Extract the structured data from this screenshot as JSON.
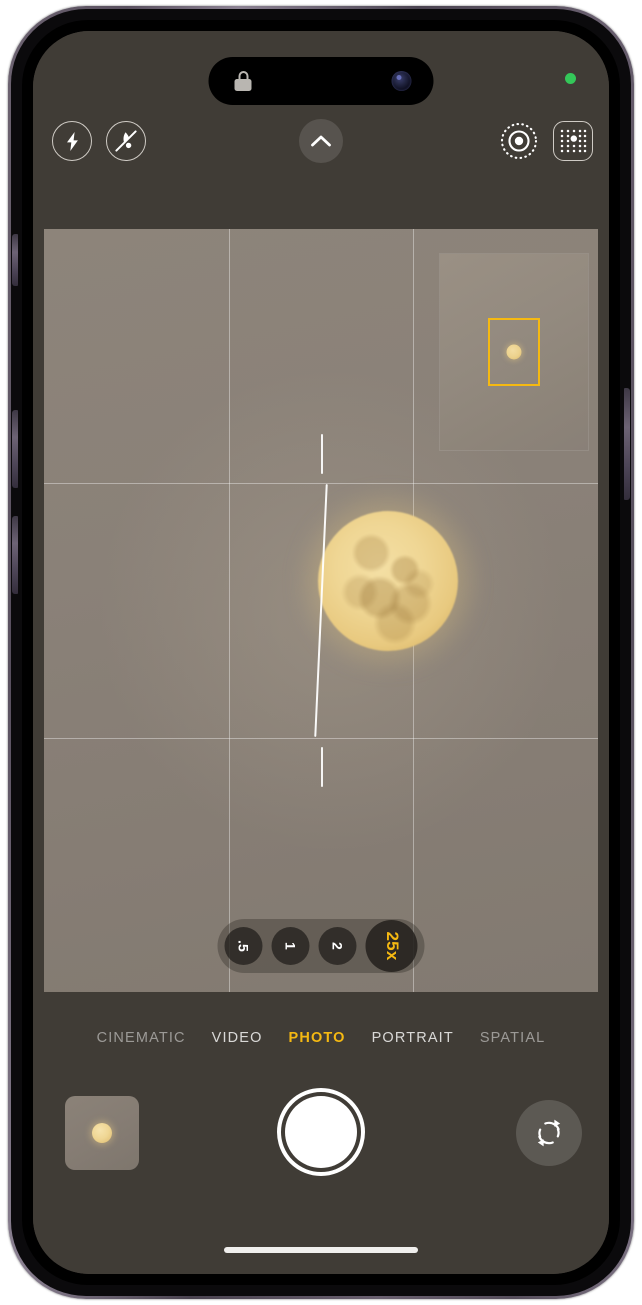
{
  "app": {
    "name": "Camera",
    "device": "iPhone"
  },
  "status": {
    "lock_icon": "lock-icon",
    "front_camera_icon": "front-camera-icon",
    "privacy_indicator": "green-camera-in-use-dot",
    "privacy_color": "#34c759"
  },
  "top_controls": [
    {
      "name": "flash-toggle",
      "icon": "flash-icon",
      "label": "Flash",
      "state": "auto"
    },
    {
      "name": "night-mode-toggle",
      "icon": "night-mode-off-icon",
      "label": "Night Mode",
      "state": "off"
    },
    {
      "name": "expand-controls",
      "icon": "chevron-up-icon",
      "label": "More Controls",
      "state": "collapsed"
    },
    {
      "name": "live-photo-toggle",
      "icon": "live-photo-icon",
      "label": "Live Photo",
      "state": "on"
    },
    {
      "name": "photographic-styles",
      "icon": "photographic-styles-icon",
      "label": "Photographic Styles",
      "state": "on"
    }
  ],
  "viewfinder": {
    "subject": "moon",
    "grid": "on",
    "grid_lines": 4,
    "level_indicator": "on",
    "level_tilt_degrees": 2.6,
    "background_color": "#8a8178",
    "moon_color": "#efd694",
    "zoom_preview": {
      "name": "zoom-preview-inset",
      "crop_box_color": "#f5b912",
      "visible": true
    }
  },
  "zoom": {
    "options": [
      {
        "label": ".5",
        "value": "0.5",
        "active": false
      },
      {
        "label": "1",
        "value": "1",
        "active": false
      },
      {
        "label": "2",
        "value": "2",
        "active": false
      },
      {
        "label": "25x",
        "value": "25",
        "active": true
      }
    ],
    "active_color": "#f5b912"
  },
  "modes": [
    {
      "label": "CINEMATIC",
      "active": false,
      "edge": true
    },
    {
      "label": "VIDEO",
      "active": false,
      "edge": false
    },
    {
      "label": "PHOTO",
      "active": true,
      "edge": false
    },
    {
      "label": "PORTRAIT",
      "active": false,
      "edge": false
    },
    {
      "label": "SPATIAL",
      "active": false,
      "edge": true
    }
  ],
  "mode_active_color": "#f5b912",
  "actions": {
    "thumbnail": {
      "name": "photo-library-thumbnail",
      "label": "Last Photo"
    },
    "shutter": {
      "name": "shutter-button",
      "label": "Take Photo"
    },
    "flip": {
      "name": "camera-flip-button",
      "icon": "camera-flip-icon",
      "label": "Switch Camera"
    }
  },
  "system": {
    "home_indicator": "home-indicator"
  }
}
